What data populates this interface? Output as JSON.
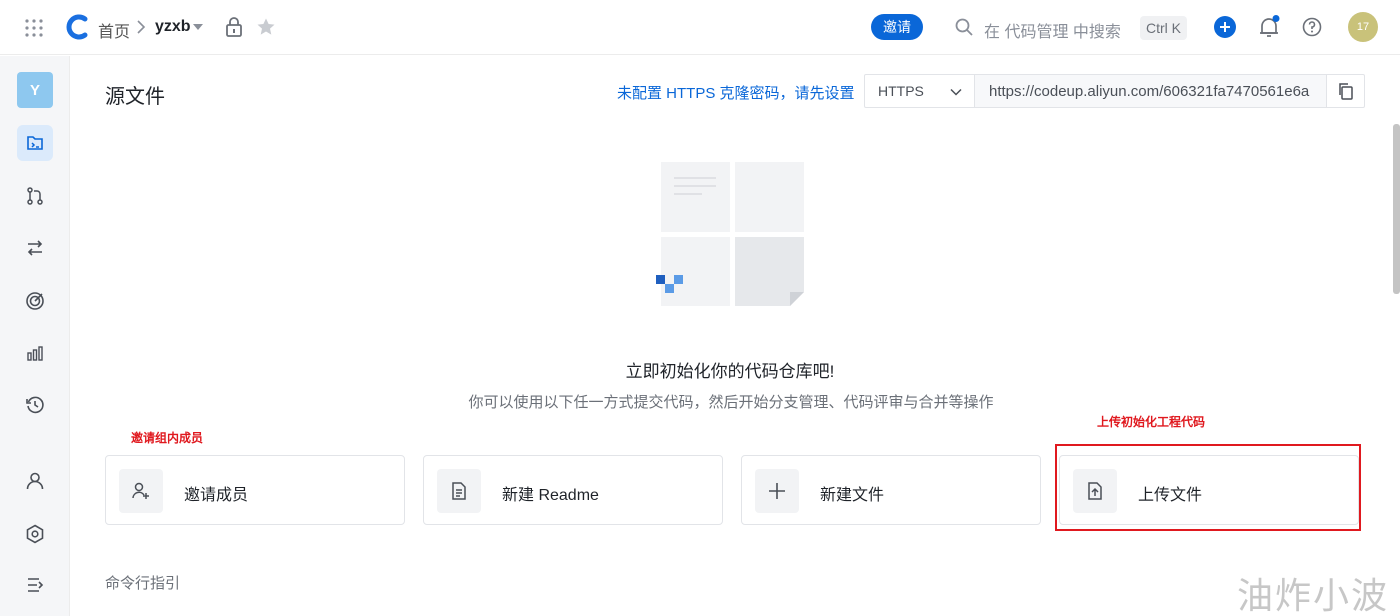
{
  "topbar": {
    "breadcrumb_home": "首页",
    "repo_name": "yzxb",
    "invite_label": "邀请",
    "search_placeholder": "在 代码管理 中搜索",
    "search_shortcut": "Ctrl K",
    "avatar_text": "17",
    "accent_color": "#0a67d8"
  },
  "sidebar": {
    "repo_initial": "Y",
    "items": [
      {
        "icon": "code-repo-icon",
        "active": true
      },
      {
        "icon": "merge-request-icon"
      },
      {
        "icon": "compare-icon"
      },
      {
        "icon": "target-icon"
      },
      {
        "icon": "bar-chart-icon"
      },
      {
        "icon": "history-icon"
      },
      {
        "icon": "member-icon"
      },
      {
        "icon": "settings-hex-icon"
      },
      {
        "icon": "collapse-menu-icon"
      }
    ]
  },
  "main": {
    "title": "源文件",
    "https_hint": "未配置 HTTPS 克隆密码，请先设置",
    "clone_protocol": "HTTPS",
    "clone_url": "https://codeup.aliyun.com/606321fa7470561e6a",
    "empty_title": "立即初始化你的代码仓库吧!",
    "empty_subtitle": "你可以使用以下任一方式提交代码，然后开始分支管理、代码评审与合并等操作",
    "cards": [
      {
        "label": "邀请成员",
        "icon": "add-user-icon"
      },
      {
        "label": "新建 Readme",
        "icon": "document-icon"
      },
      {
        "label": "新建文件",
        "icon": "plus-icon"
      },
      {
        "label": "上传文件",
        "icon": "upload-icon"
      }
    ],
    "cli_title": "命令行指引"
  },
  "annotations": {
    "left": "邀请组内成员",
    "right": "上传初始化工程代码",
    "color": "#e0191f"
  },
  "watermark": "油炸小波"
}
